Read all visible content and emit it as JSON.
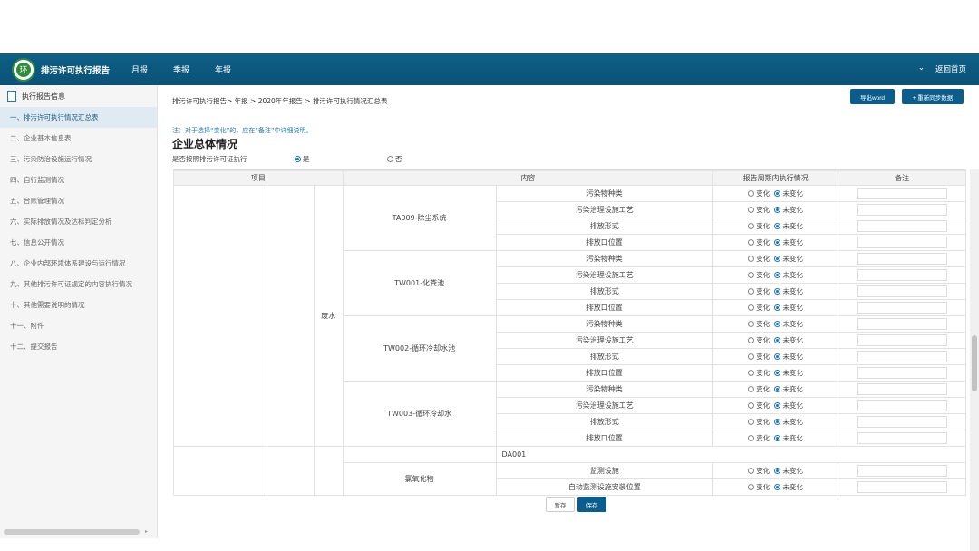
{
  "app": {
    "title": "排污许可执行报告",
    "nav": [
      "月报",
      "季报",
      "年报"
    ],
    "right_expand": "⌄",
    "right_back": "返回首页"
  },
  "sidebar": {
    "header": "执行报告信息",
    "items": [
      "一、排污许可执行情况汇总表",
      "二、企业基本信息表",
      "三、污染防治设施运行情况",
      "四、自行监测情况",
      "五、台账管理情况",
      "六、实际排放情况及达标判定分析",
      "七、信息公开情况",
      "八、企业内部环境体系建设与运行情况",
      "九、其他排污许可证规定的内容执行情况",
      "十、其他需要说明的情况",
      "十一、附件",
      "十二、提交报告"
    ]
  },
  "main": {
    "breadcrumb": "排污许可执行报告> 年报 > 2020年年报告 > 排污许可执行情况汇总表",
    "btn_word": "导出word",
    "btn_sync": "+ 重新同步数据",
    "note": "注：对于选择“变化”的，应在“备注”中详细说明。",
    "heading": "企业总体情况",
    "question": "是否按照排污许可证执行",
    "yes": "是",
    "no": "否",
    "btn_temp": "暂存",
    "btn_save": "保存"
  },
  "table": {
    "headers": {
      "item": "项目",
      "content": "内容",
      "status": "报告周期内执行情况",
      "remark": "备注"
    },
    "water_label": "废水",
    "change": "变化",
    "nochange": "未变化",
    "groups": [
      {
        "name": "TA009-除尘系统",
        "rows": [
          "污染物种类",
          "污染治理设施工艺",
          "排放形式",
          "排放口位置"
        ]
      },
      {
        "name": "TW001-化粪池",
        "rows": [
          "污染物种类",
          "污染治理设施工艺",
          "排放形式",
          "排放口位置"
        ]
      },
      {
        "name": "TW002-循环冷却水池",
        "rows": [
          "污染物种类",
          "污染治理设施工艺",
          "排放形式",
          "排放口位置"
        ]
      },
      {
        "name": "TW003-循环冷却水",
        "rows": [
          "污染物种类",
          "污染治理设施工艺",
          "排放形式",
          "排放口位置"
        ]
      }
    ],
    "da_label": "DA001",
    "da_group": "氯氧化物",
    "da_rows": [
      "监测设施",
      "自动监测设施安装位置"
    ]
  },
  "colors": {
    "topbar": "#0b5277",
    "primary": "#0b5d8d",
    "active_side": "#dfeaf3",
    "note": "#1f79b4"
  }
}
